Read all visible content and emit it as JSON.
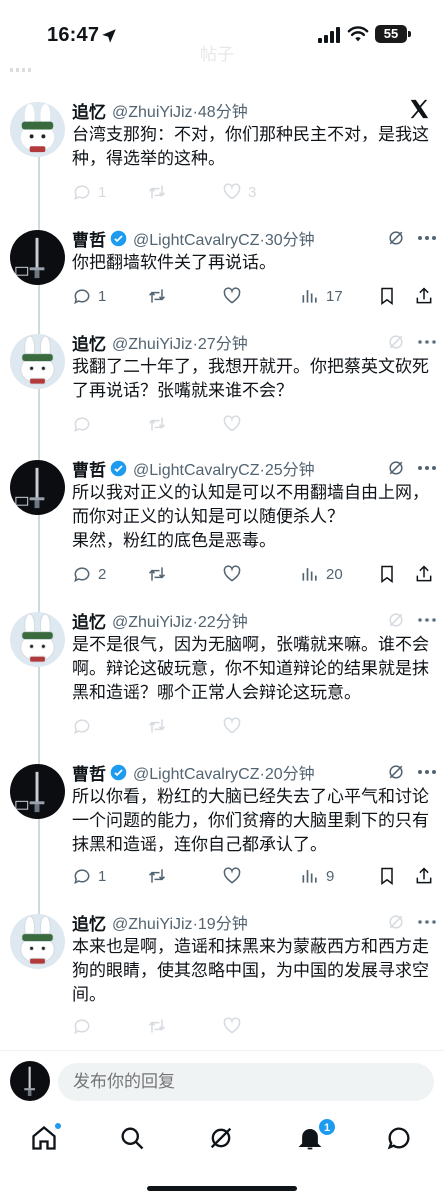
{
  "status_bar": {
    "time": "16:47",
    "battery": "55"
  },
  "faded_header": {
    "title": "帖子"
  },
  "tweets": [
    {
      "name": "追忆",
      "handle": "@ZhuiYiJiz",
      "time": "48分钟",
      "text": "台湾支那狗：不对，你们那种民主不对，是我这种，得选举的这种。",
      "replies": "1",
      "retweets": "",
      "likes": "3",
      "views": "",
      "avatar": "rabbit-avatar"
    },
    {
      "name": "曹哲",
      "handle": "@LightCavalryCZ",
      "time": "30分钟",
      "text": "你把翻墙软件关了再说话。",
      "replies": "1",
      "retweets": "",
      "likes": "",
      "views": "17",
      "avatar": "knight-avatar"
    },
    {
      "name": "追忆",
      "handle": "@ZhuiYiJiz",
      "time": "27分钟",
      "text": "我翻了二十年了，我想开就开。你把蔡英文砍死了再说话？张嘴就来谁不会？",
      "replies": "",
      "retweets": "",
      "likes": "",
      "views": "",
      "avatar": "rabbit-avatar"
    },
    {
      "name": "曹哲",
      "handle": "@LightCavalryCZ",
      "time": "25分钟",
      "text": "所以我对正义的认知是可以不用翻墙自由上网，而你对正义的认知是可以随便杀人？\n果然，粉红的底色是恶毒。",
      "replies": "2",
      "retweets": "",
      "likes": "",
      "views": "20",
      "avatar": "knight-avatar"
    },
    {
      "name": "追忆",
      "handle": "@ZhuiYiJiz",
      "time": "22分钟",
      "text": "是不是很气，因为无脑啊，张嘴就来嘛。谁不会啊。辩论这破玩意，你不知道辩论的结果就是抹黑和造谣？哪个正常人会辩论这玩意。",
      "replies": "",
      "retweets": "",
      "likes": "",
      "views": "",
      "avatar": "rabbit-avatar"
    },
    {
      "name": "曹哲",
      "handle": "@LightCavalryCZ",
      "time": "20分钟",
      "text": "所以你看，粉红的大脑已经失去了心平气和讨论一个问题的能力，你们贫瘠的大脑里剩下的只有抹黑和造谣，连你自己都承认了。",
      "replies": "1",
      "retweets": "",
      "likes": "",
      "views": "9",
      "avatar": "knight-avatar"
    },
    {
      "name": "追忆",
      "handle": "@ZhuiYiJiz",
      "time": "19分钟",
      "text": "本来也是啊，造谣和抹黑来为蒙蔽西方和西方走狗的眼睛，使其忽略中国，为中国的发展寻求空间。",
      "replies": "",
      "retweets": "",
      "likes": "",
      "views": "",
      "avatar": "rabbit-avatar"
    }
  ],
  "reply_bar": {
    "placeholder": "发布你的回复"
  },
  "tab_bar": {
    "notifications_badge": "1"
  },
  "colors": {
    "accent": "#1d9bf0",
    "secondary_text": "#536471",
    "divider": "#eff3f4"
  }
}
